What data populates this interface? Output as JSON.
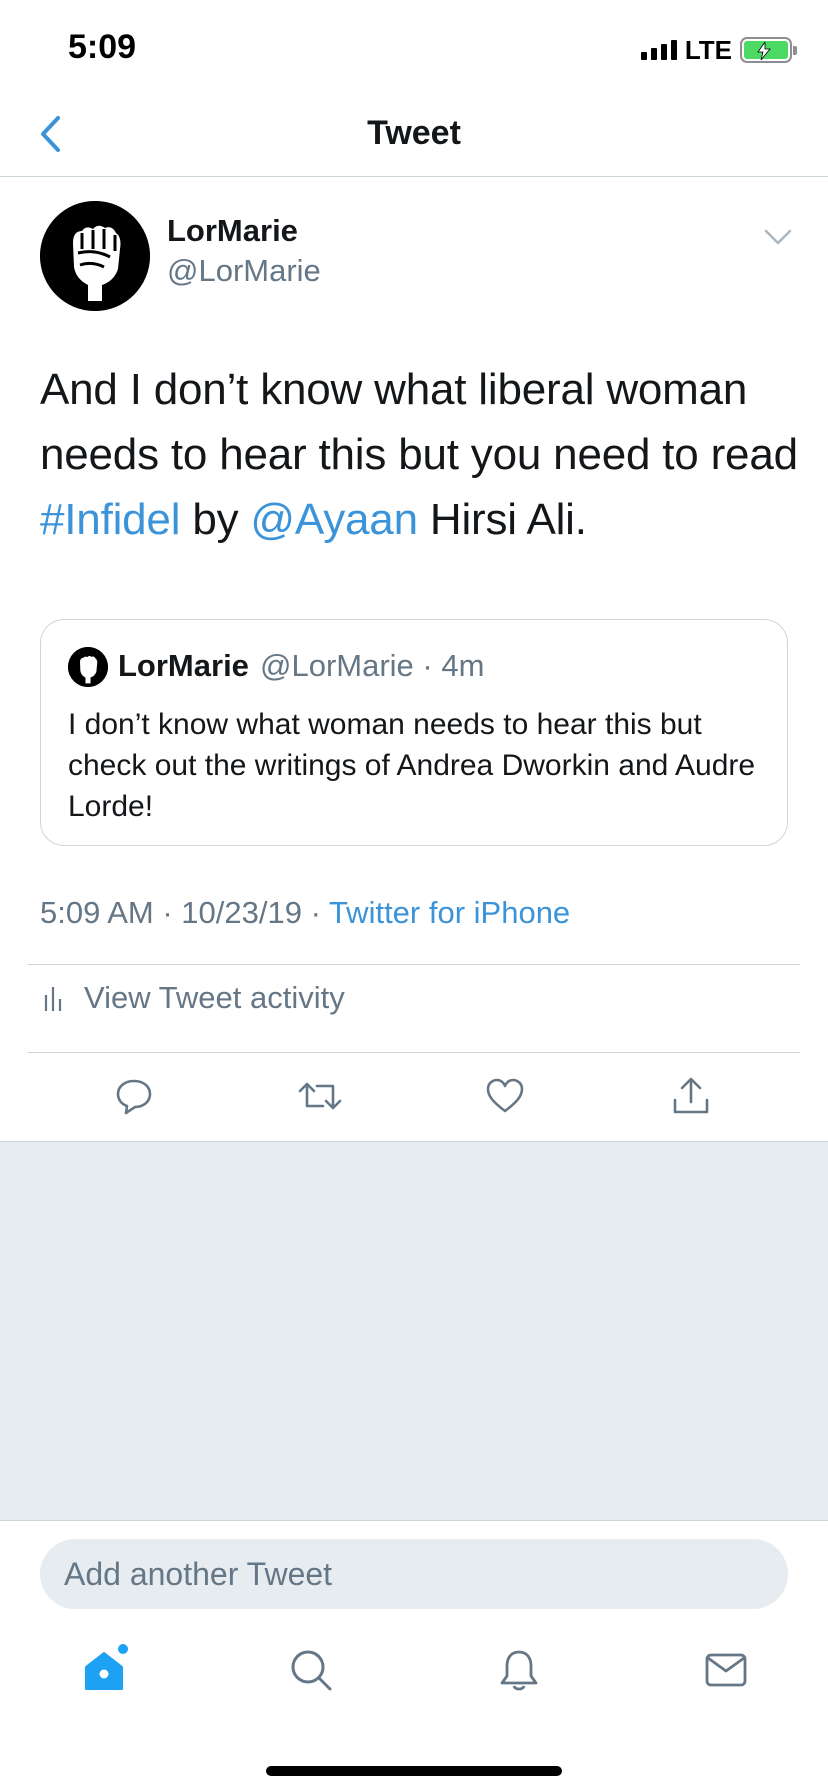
{
  "status_bar": {
    "time": "5:09",
    "network": "LTE"
  },
  "header": {
    "title": "Tweet",
    "back_icon": "chevron-left-icon"
  },
  "tweet": {
    "author_name": "LorMarie",
    "author_handle": "@LorMarie",
    "text_parts": {
      "p1": "And I don’t know what liberal woman needs to hear this but you need to read ",
      "hashtag": "#Infidel",
      "p2": " by ",
      "mention": "@Ayaan",
      "p3": " Hirsi Ali."
    },
    "quoted": {
      "author_name": "LorMarie",
      "author_handle_time": "@LorMarie · 4m",
      "text": "I don’t know what woman needs to hear this but check out the writings of Andrea Dworkin and Audre Lorde!"
    },
    "meta_time": "5:09 AM · 10/23/19 · ",
    "meta_source": "Twitter for iPhone",
    "activity_label": "View Tweet activity"
  },
  "actions": [
    "reply-icon",
    "retweet-icon",
    "like-icon",
    "share-icon"
  ],
  "composer": {
    "placeholder": "Add another Tweet"
  },
  "tabbar": {
    "items": [
      "home-icon",
      "search-icon",
      "notifications-icon",
      "messages-icon"
    ],
    "active": "home-icon"
  },
  "colors": {
    "accent": "#3b94d9",
    "secondary_text": "#657786",
    "background_gray": "#e6ecf0",
    "battery": "#4cd964"
  }
}
